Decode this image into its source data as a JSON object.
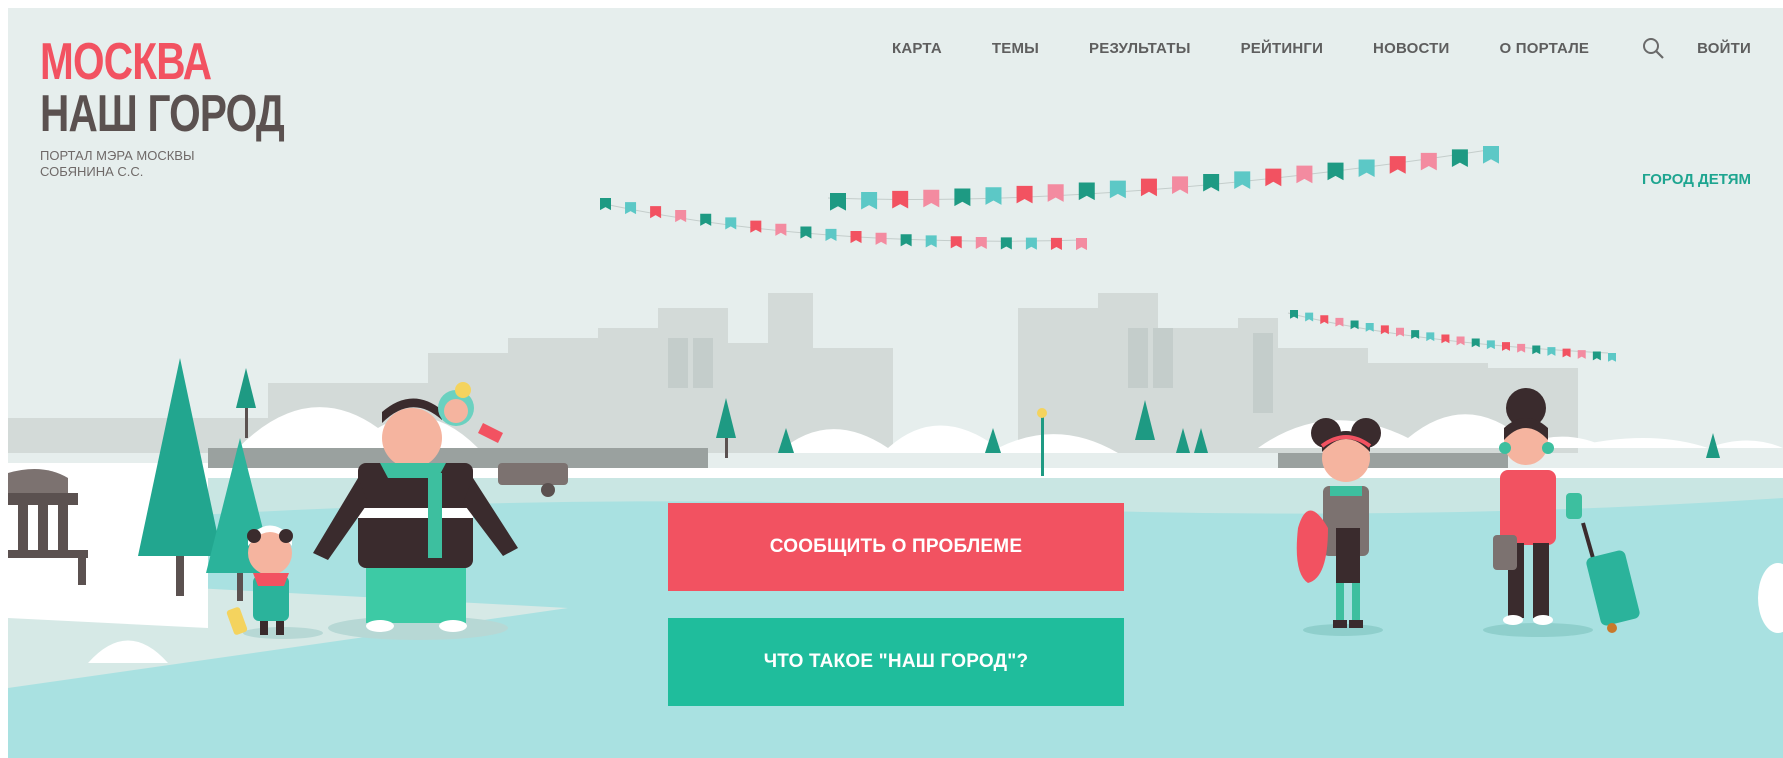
{
  "logo": {
    "line1": "МОСКВА",
    "line2": "НАШ ГОРОД",
    "subtitle": "ПОРТАЛ МЭРА МОСКВЫ СОБЯНИНА С.С."
  },
  "nav": {
    "items": [
      "КАРТА",
      "ТЕМЫ",
      "РЕЗУЛЬТАТЫ",
      "РЕЙТИНГИ",
      "НОВОСТИ",
      "О ПОРТАЛЕ"
    ],
    "search_icon": "search-icon",
    "login": "ВОЙТИ"
  },
  "kids_link": "ГОРОД ДЕТЯМ",
  "cta": {
    "report": "СООБЩИТЬ О ПРОБЛЕМЕ",
    "about": "ЧТО ТАКОЕ \"НАШ ГОРОД\"?"
  },
  "colors": {
    "brand_red": "#f25261",
    "brand_green": "#1fbd9c",
    "dark_text": "#5b5150",
    "kids_link": "#1ea590",
    "sky": "#e6eeed",
    "ice": "#a9e1e1"
  }
}
